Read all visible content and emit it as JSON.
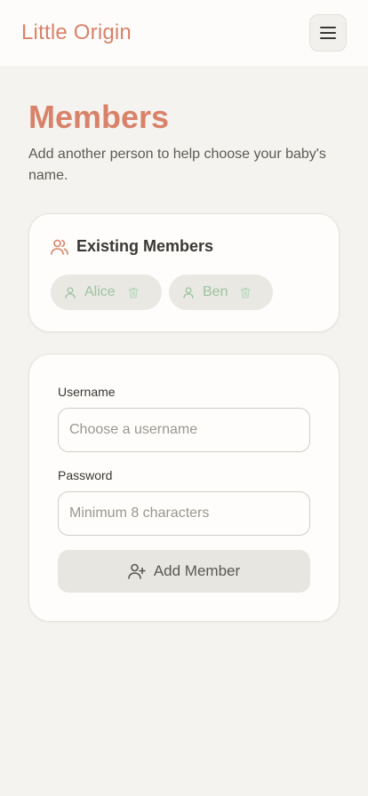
{
  "header": {
    "brand": "Little Origin",
    "menu_icon": "hamburger-menu-icon"
  },
  "page": {
    "title": "Members",
    "subtitle": "Add another person to help choose your baby's name."
  },
  "members": {
    "title": "Existing Members",
    "icon": "users-icon",
    "items": [
      {
        "name": "Alice",
        "icon": "user-icon",
        "action_icon": "trash-icon"
      },
      {
        "name": "Ben",
        "icon": "user-icon",
        "action_icon": "trash-icon"
      }
    ]
  },
  "form": {
    "username_label": "Username",
    "username_placeholder": "Choose a username",
    "username_value": "",
    "password_label": "Password",
    "password_placeholder": "Minimum 8 characters",
    "password_value": "",
    "submit_label": "Add Member",
    "submit_icon": "user-plus-icon"
  },
  "colors": {
    "accent": "#d9826a",
    "chip_text": "#9cc4a0",
    "background": "#f4f3ef"
  }
}
